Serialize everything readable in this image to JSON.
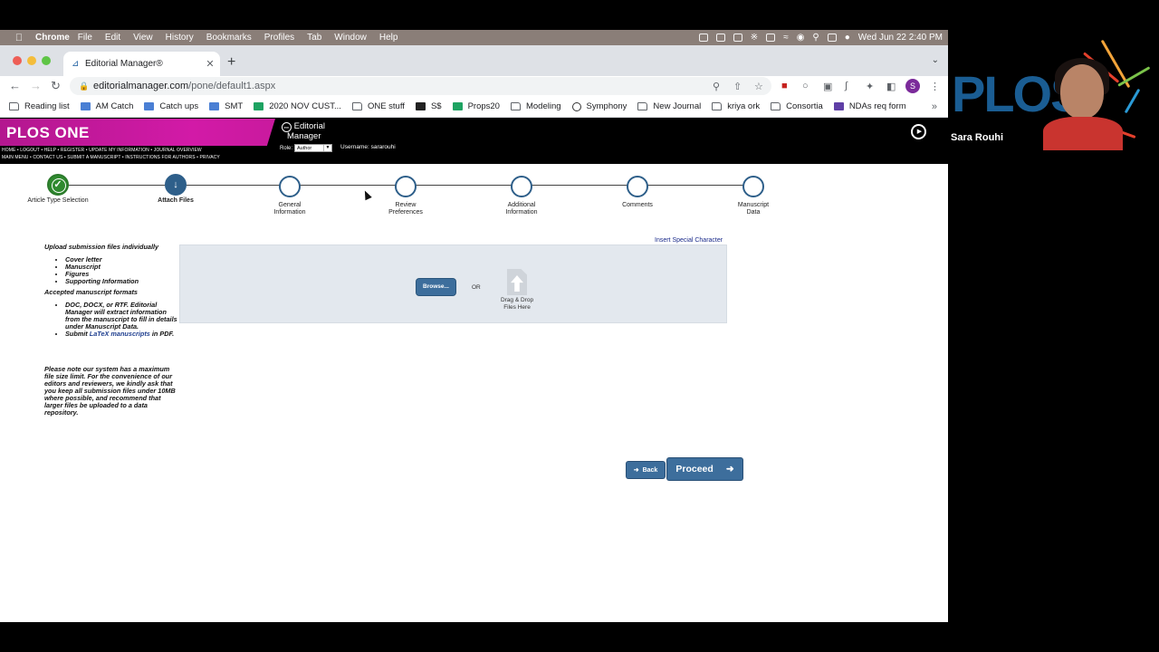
{
  "menubar": {
    "app": "Chrome",
    "items": [
      "File",
      "Edit",
      "View",
      "History",
      "Bookmarks",
      "Profiles",
      "Tab",
      "Window",
      "Help"
    ],
    "datetime": "Wed Jun 22  2:40 PM"
  },
  "browser": {
    "tab_title": "Editorial Manager®",
    "url_host": "editorialmanager.com",
    "url_path": "/pone/default1.aspx",
    "profile_initial": "S",
    "bookmarks": [
      {
        "label": "Reading list",
        "icon": "folder"
      },
      {
        "label": "AM Catch",
        "icon": "doc"
      },
      {
        "label": "Catch ups",
        "icon": "doc"
      },
      {
        "label": "SMT",
        "icon": "doc"
      },
      {
        "label": "2020 NOV CUST...",
        "icon": "sheet"
      },
      {
        "label": "ONE stuff",
        "icon": "folder"
      },
      {
        "label": "S$",
        "icon": "dark"
      },
      {
        "label": "Props20",
        "icon": "sheet"
      },
      {
        "label": "Modeling",
        "icon": "folder"
      },
      {
        "label": "Symphony",
        "icon": "globe"
      },
      {
        "label": "New Journal",
        "icon": "folder"
      },
      {
        "label": "kriya ork",
        "icon": "folder"
      },
      {
        "label": "Consortia",
        "icon": "folder"
      },
      {
        "label": "NDAs req form",
        "icon": "purple"
      }
    ]
  },
  "header": {
    "journal_logo": "PLOS ONE",
    "links_row1": "HOME  •  LOGOUT  •  HELP  •  REGISTER  •  UPDATE MY INFORMATION  •  JOURNAL OVERVIEW",
    "links_row2": "MAIN MENU  •  CONTACT US  •  SUBMIT A MANUSCRIPT  •  INSTRUCTIONS FOR AUTHORS  •  PRIVACY",
    "em_logo_line1": "Editorial",
    "em_logo_line2": "Manager",
    "em_logo_mark": "em",
    "role_label": "Role:",
    "role_value": "Author",
    "username": "Username: sararouhi"
  },
  "steps": [
    {
      "label": "Article Type Selection",
      "state": "done"
    },
    {
      "label": "Attach Files",
      "state": "active"
    },
    {
      "label": "General Information",
      "state": "pending"
    },
    {
      "label": "Review Preferences",
      "state": "pending"
    },
    {
      "label": "Additional Information",
      "state": "pending"
    },
    {
      "label": "Comments",
      "state": "pending"
    },
    {
      "label": "Manuscript Data",
      "state": "pending"
    }
  ],
  "instructions": {
    "heading1": "Upload submission files individually",
    "files": [
      "Cover letter",
      "Manuscript",
      "Figures",
      "Supporting Information"
    ],
    "heading2": "Accepted manuscript formats",
    "format1": "DOC, DOCX, or RTF. Editorial Manager will extract information from the manuscript to fill in details under Manuscript Data.",
    "format2_pre": "Submit ",
    "format2_link": "LaTeX manuscripts",
    "format2_post": " in PDF.",
    "note": "Please note our system has a maximum file size limit. For the convenience of our editors and reviewers, we kindly ask that you keep all submission files under 10MB where possible, and recommend that larger files be uploaded to a data repository."
  },
  "upload": {
    "special_char_link": "Insert Special Character",
    "browse_label": "Browse...",
    "or_text": "OR",
    "drop_line1": "Drag & Drop",
    "drop_line2": "Files Here"
  },
  "nav": {
    "back_label": "Back",
    "proceed_label": "Proceed"
  },
  "presenter": {
    "name": "Sara Rouhi",
    "background_text": "PLOS"
  }
}
